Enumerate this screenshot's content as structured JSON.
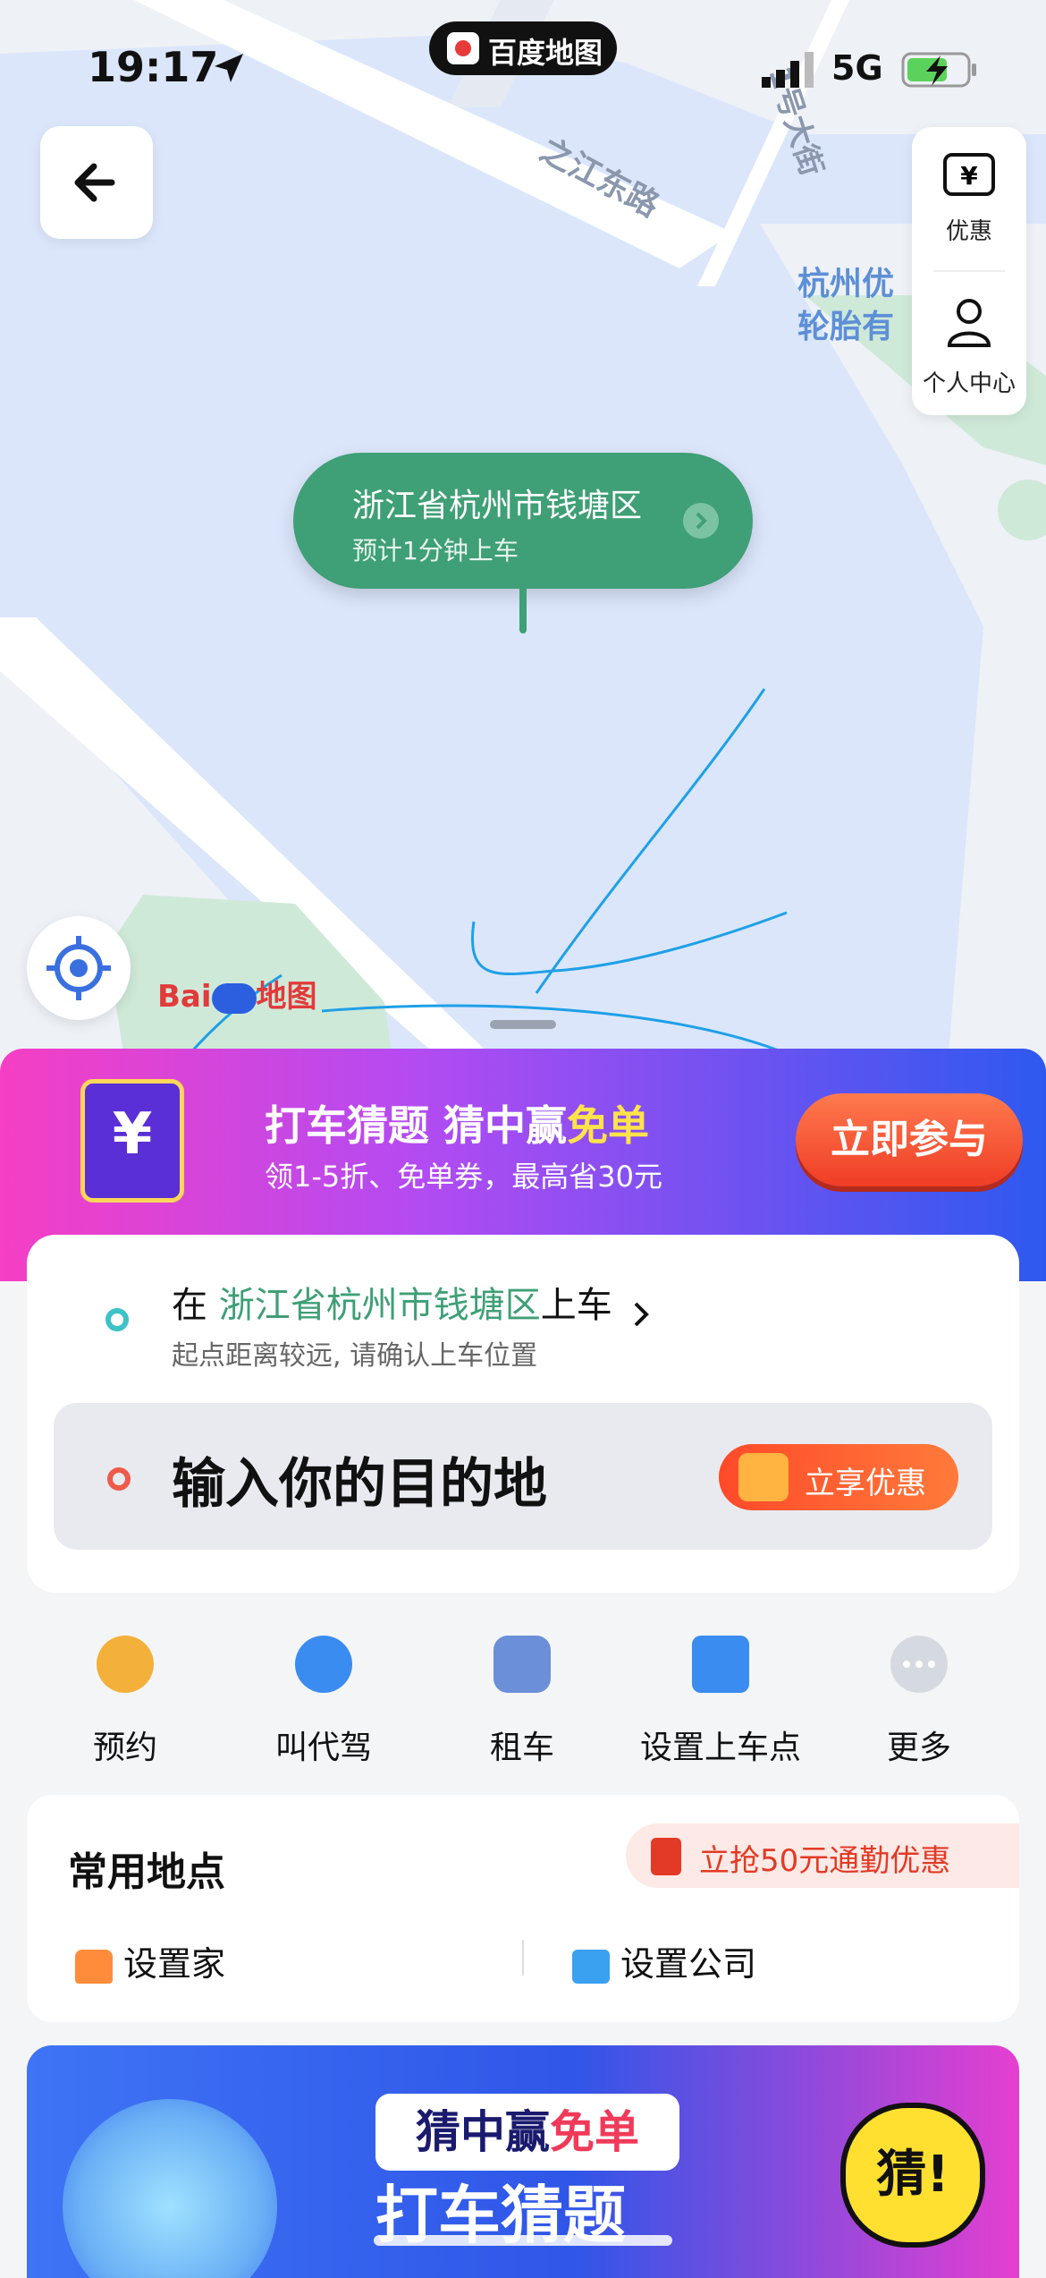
{
  "status_bar": {
    "time": "19:17",
    "network": "5G"
  },
  "app_pill": {
    "title": "百度地图"
  },
  "map": {
    "road_label_1": "之江东路",
    "road_label_2": "1号大街",
    "poi_line_1": "杭州优",
    "poi_line_2": "轮胎有",
    "logo_text_1": "Bai",
    "logo_text_2": "地图"
  },
  "side_menu": {
    "offer_label": "优惠",
    "profile_label": "个人中心"
  },
  "pickup_bubble": {
    "title": "浙江省杭州市钱塘区",
    "subtitle": "预计1分钟上车"
  },
  "promo_banner": {
    "title_part1": "打车猜题 猜中赢",
    "title_part2": "免单",
    "subtitle": "领1-5折、免单券，最高省30元",
    "button": "立即参与"
  },
  "route": {
    "start_prefix": "在 ",
    "start_location": "浙江省杭州市钱塘区",
    "start_suffix": "上车",
    "start_hint": "起点距离较远, 请确认上车位置",
    "destination_placeholder": "输入你的目的地",
    "offer_button": "立享优惠"
  },
  "services": [
    {
      "label": "预约",
      "icon": "clock-icon",
      "color": "#f3b03a"
    },
    {
      "label": "叫代驾",
      "icon": "driver-icon",
      "color": "#3a8cf0"
    },
    {
      "label": "租车",
      "icon": "rental-car-icon",
      "color": "#6b8fd8"
    },
    {
      "label": "设置上车点",
      "icon": "pickup-point-icon",
      "color": "#3a8cf0"
    },
    {
      "label": "更多",
      "icon": "more-icon",
      "color": "#d5d9e0"
    }
  ],
  "common_places": {
    "title": "常用地点",
    "commute_offer": "立抢50元通勤优惠",
    "home": "设置家",
    "work": "设置公司"
  },
  "bottom_banner": {
    "title_part1": "猜中赢",
    "title_part2": "免单",
    "subtitle": "打车猜题",
    "badge": "猜!"
  },
  "colors": {
    "accent_green": "#3f9f76",
    "accent_red": "#ef3d25",
    "map_water": "#dbe6fb"
  }
}
